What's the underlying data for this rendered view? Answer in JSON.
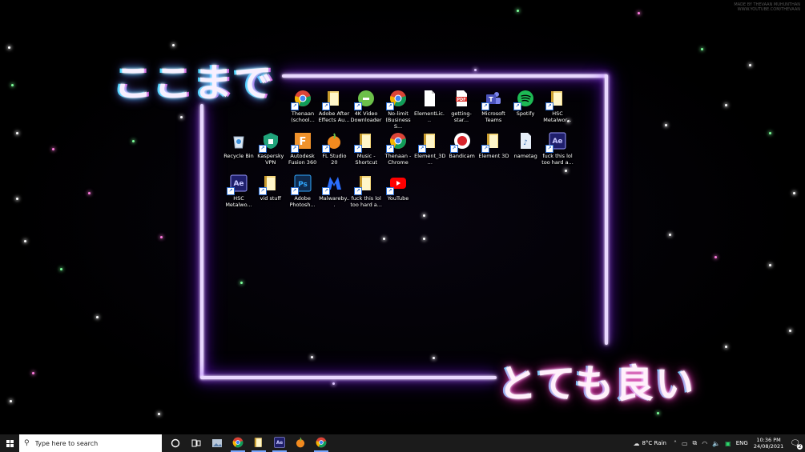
{
  "watermark": {
    "line1": "MADE BY THEVAAN MUHUNTHAN",
    "line2": "WWW.YOUTUBE.COM/THEVAAN"
  },
  "wallpaper": {
    "text_top": "ここまで",
    "text_bottom": "とても良い",
    "accent": "#b57bff"
  },
  "desktop_icons": [
    {
      "label": "Thenaan (school...",
      "icon": "chrome-icon",
      "color": "#1a73e8"
    },
    {
      "label": "Adobe After Effects Au...",
      "icon": "folder-icon",
      "color": "#e8c15a"
    },
    {
      "label": "4K Video Downloader",
      "icon": "download-icon",
      "color": "#6cc04a"
    },
    {
      "label": "No-limit (Business S...",
      "icon": "chrome-icon",
      "color": "#1a73e8"
    },
    {
      "label": "ElementLic...",
      "icon": "document-icon",
      "color": "#f2f2f2"
    },
    {
      "label": "getting-star...",
      "icon": "pdf-icon",
      "color": "#d9302b"
    },
    {
      "label": "Microsoft Teams",
      "icon": "teams-icon",
      "color": "#5b5fc7"
    },
    {
      "label": "Spotify",
      "icon": "spotify-icon",
      "color": "#1db954"
    },
    {
      "label": "HSC Metalwor...",
      "icon": "folder-icon",
      "color": "#e8c15a"
    },
    {
      "label": "Recycle Bin",
      "icon": "recycle-bin-icon",
      "color": "#cfd8e3"
    },
    {
      "label": "Kaspersky VPN",
      "icon": "vpn-icon",
      "color": "#20a37a"
    },
    {
      "label": "Autodesk Fusion 360",
      "icon": "fusion-icon",
      "color": "#f0922b"
    },
    {
      "label": "FL Studio 20",
      "icon": "fl-studio-icon",
      "color": "#f28a1f"
    },
    {
      "label": "Music - Shortcut",
      "icon": "folder-icon",
      "color": "#e8c15a"
    },
    {
      "label": "Thenaan - Chrome",
      "icon": "chrome-icon",
      "color": "#1a73e8"
    },
    {
      "label": "Element_3D...",
      "icon": "folder-icon",
      "color": "#e8c15a"
    },
    {
      "label": "Bandicam",
      "icon": "bandicam-icon",
      "color": "#d8242b"
    },
    {
      "label": "Element 3D",
      "icon": "folder-icon",
      "color": "#e8c15a"
    },
    {
      "label": "nametag",
      "icon": "audio-file-icon",
      "color": "#e6eef8"
    },
    {
      "label": "fuck this lol too hard a...",
      "icon": "after-effects-icon",
      "color": "#1f1f6b"
    },
    {
      "label": "HSC Metalwo...",
      "icon": "after-effects-icon",
      "color": "#1f1f6b"
    },
    {
      "label": "vid stuff",
      "icon": "folder-icon",
      "color": "#e8c15a"
    },
    {
      "label": "Adobe Photosh...",
      "icon": "photoshop-icon",
      "color": "#0f2a4d"
    },
    {
      "label": "Malwareby...",
      "icon": "malwarebytes-icon",
      "color": "#1c3fa8"
    },
    {
      "label": "fuck this lol too hard a...",
      "icon": "folder-icon",
      "color": "#e8c15a"
    },
    {
      "label": "YouTube",
      "icon": "youtube-icon",
      "color": "#ff0000"
    }
  ],
  "taskbar": {
    "search_placeholder": "Type here to search",
    "apps": [
      {
        "name": "cortana",
        "icon": "circle-icon"
      },
      {
        "name": "task-view",
        "icon": "task-view-icon"
      },
      {
        "name": "photos",
        "icon": "photos-icon"
      },
      {
        "name": "chrome",
        "icon": "chrome-icon",
        "active": true
      },
      {
        "name": "file-explorer",
        "icon": "folder-icon",
        "active": true
      },
      {
        "name": "after-effects",
        "icon": "after-effects-icon",
        "active": true
      },
      {
        "name": "fl-studio",
        "icon": "fl-studio-icon"
      },
      {
        "name": "chrome-profile",
        "icon": "chrome-icon",
        "active": true
      }
    ],
    "weather": {
      "temp": "8°C",
      "condition": "Rain"
    },
    "language": "ENG",
    "time": "10:36 PM",
    "date": "24/08/2021",
    "notification_count": "2"
  }
}
